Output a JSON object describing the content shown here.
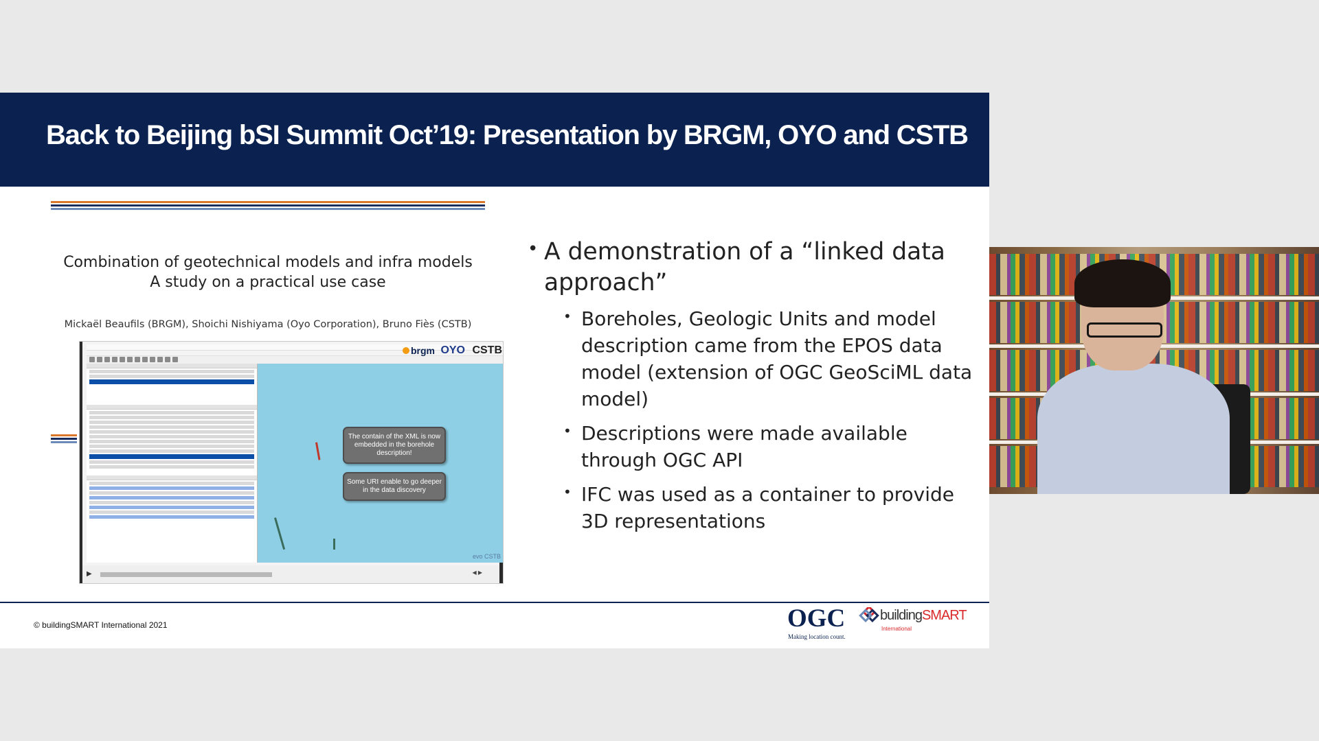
{
  "slide": {
    "title": "Back to Beijing bSI Summit Oct’19: Presentation by BRGM, OYO and CSTB",
    "left_caption_line1": "Combination of geotechnical models and infra models",
    "left_caption_line2": "A study on a practical use case",
    "authors": "Mickaël Beaufils (BRGM), Shoichi Nishiyama (Oyo Corporation), Bruno Fiès (CSTB)",
    "bullets": {
      "main": "A demonstration of a “linked data approach”",
      "sub": [
        "Boreholes, Geologic Units and model description came from the EPOS data model (extension of OGC GeoSciML data model)",
        "Descriptions were made available through OGC API",
        "IFC was used as a container to provide 3D representations"
      ]
    },
    "copyright": "© buildingSMART International 2021"
  },
  "video": {
    "bubble_1": "The contain of the XML is now embedded in the borehole description!",
    "bubble_2": "Some URI enable to go deeper in the data discovery",
    "logo_brgm": "brgm",
    "logo_oyo": "OYO",
    "logo_cstb": "CSTB",
    "brand": "evo CSTB",
    "play_icon": "play-icon"
  },
  "logos": {
    "ogc": "OGC",
    "ogc_tagline": "Making location count.",
    "bs_prefix": "building",
    "bs_suffix": "SMART",
    "bs_sub": "International"
  },
  "colors": {
    "header_navy": "#0b2250",
    "stripe_orange": "#d9772b",
    "stripe_navy": "#1a2c5b",
    "stripe_blue": "#6b8ab8",
    "bs_red": "#d9292b"
  }
}
